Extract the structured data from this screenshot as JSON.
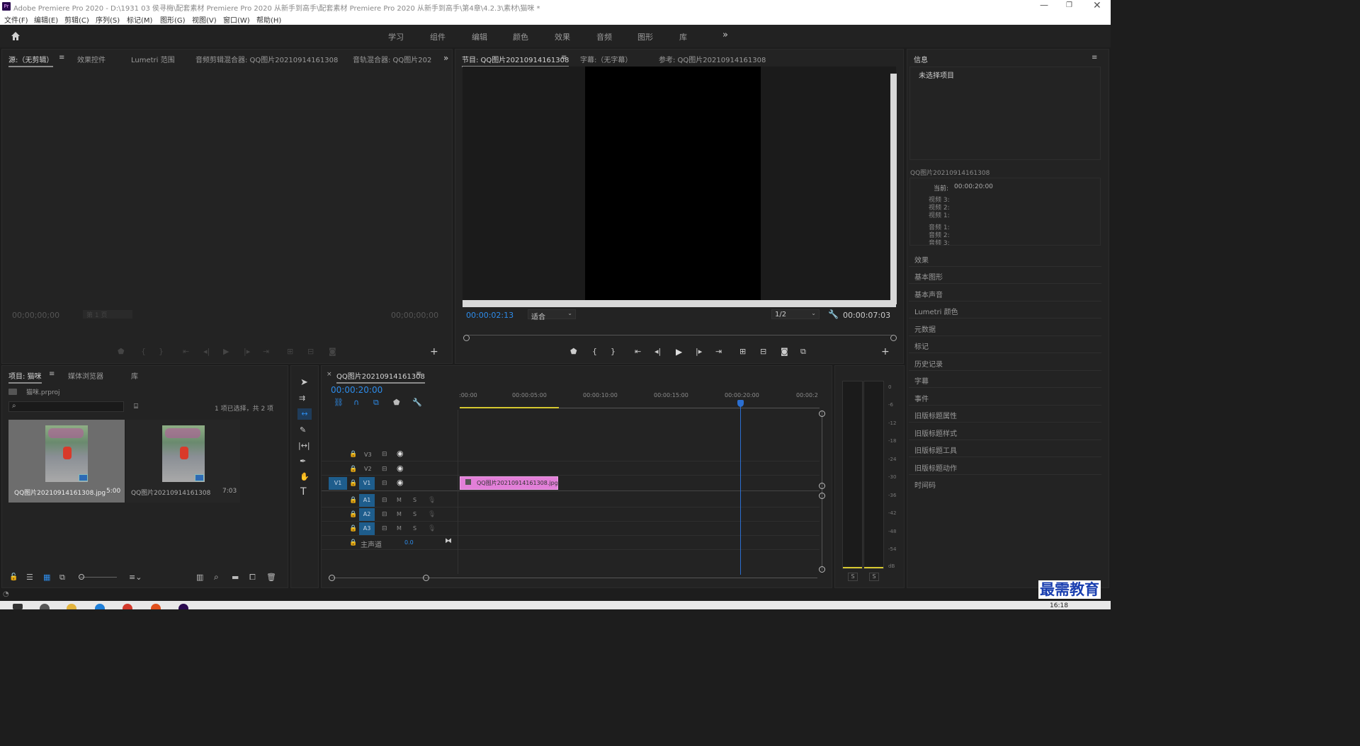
{
  "window": {
    "title": "Adobe Premiere Pro 2020 - D:\\1931 03 侯寻梅\\配套素材 Premiere Pro 2020 从新手到高手\\配套素材 Premiere Pro 2020 从新手到高手\\第4章\\4.2.3\\素材\\猫咪 *",
    "app_icon": "Pr"
  },
  "menu": [
    "文件(F)",
    "编辑(E)",
    "剪辑(C)",
    "序列(S)",
    "标记(M)",
    "图形(G)",
    "视图(V)",
    "窗口(W)",
    "帮助(H)"
  ],
  "workspaces": [
    "学习",
    "组件",
    "编辑",
    "颜色",
    "效果",
    "音频",
    "图形",
    "库"
  ],
  "source": {
    "tabs": [
      "源:（无剪辑）",
      "效果控件",
      "Lumetri 范围",
      "音频剪辑混合器: QQ图片20210914161308",
      "音轨混合器: QQ图片202"
    ],
    "tc_left": "00;00;00;00",
    "page": "第 1 页",
    "tc_right": "00;00;00;00"
  },
  "program": {
    "tabs": [
      "节目: QQ图片20210914161308",
      "字幕:（无字幕）",
      "参考: QQ图片20210914161308"
    ],
    "timecode": "00:00:02:13",
    "fit": "适合",
    "resolution": "1/2",
    "duration": "00:00:07:03"
  },
  "info": {
    "tab": "信息",
    "no_selection": "未选择项目",
    "clip_name": "QQ图片20210914161308",
    "current_label": "当前:",
    "current_value": "00:00:20:00",
    "video": [
      "视频 3:",
      "视频 2:",
      "视频 1:"
    ],
    "audio": [
      "音频 1:",
      "音频 2:",
      "音频 3:"
    ]
  },
  "side_panels": [
    "效果",
    "基本图形",
    "基本声音",
    "Lumetri 颜色",
    "元数据",
    "标记",
    "历史记录",
    "字幕",
    "事件",
    "旧版标题属性",
    "旧版标题样式",
    "旧版标题工具",
    "旧版标题动作",
    "时间码"
  ],
  "project": {
    "tabs": [
      "项目: 猫咪",
      "媒体浏览器",
      "库"
    ],
    "file": "猫咪.prproj",
    "status": "1 项已选择，共 2 项",
    "items": [
      {
        "name": "QQ图片20210914161308.jpg",
        "duration": "5:00"
      },
      {
        "name": "QQ图片20210914161308",
        "duration": "7:03"
      }
    ]
  },
  "timeline": {
    "tab": "QQ图片20210914161308",
    "timecode": "00:00:20:00",
    "ruler": [
      ":00:00",
      "00:00:05:00",
      "00:00:10:00",
      "00:00:15:00",
      "00:00:20:00",
      "00:00:2"
    ],
    "video_tracks": [
      "V3",
      "V2",
      "V1"
    ],
    "audio_tracks": [
      "A1",
      "A2",
      "A3"
    ],
    "master_label": "主声道",
    "master_value": "0.0",
    "clip_label": "QQ图片20210914161308.jpg",
    "src_patch": "V1"
  },
  "meter": {
    "labels": [
      "0",
      "-6",
      "-12",
      "-18",
      "-24",
      "-30",
      "-36",
      "-42",
      "-48",
      "-54",
      "dB"
    ],
    "solo": [
      "S",
      "S"
    ]
  },
  "watermark": "最需教育",
  "clock": "16:18",
  "colors": {
    "accent": "#2d8ceb",
    "clip": "#e27fd8",
    "playhead": "#2b6fd1",
    "track_blue": "#1e5d8c"
  }
}
